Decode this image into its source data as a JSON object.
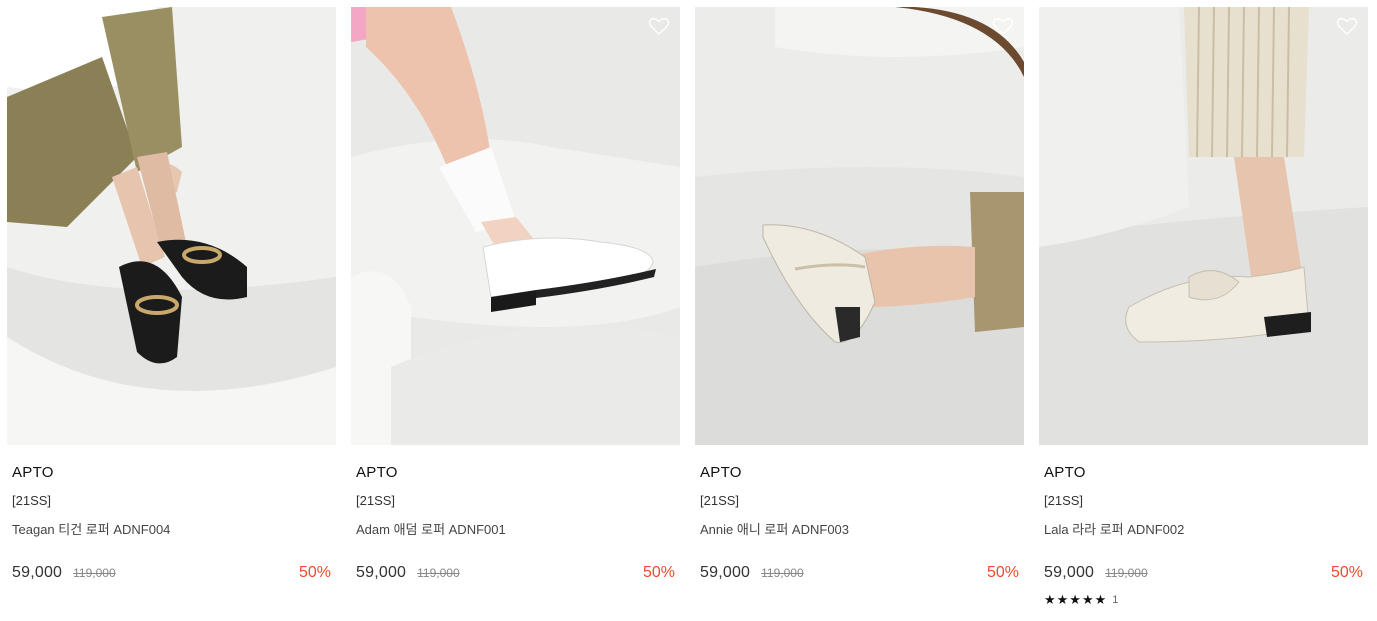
{
  "products": [
    {
      "brand": "APTO",
      "season": "[21SS]",
      "name": "Teagan 티건 로퍼 ADNF004",
      "price": "59,000",
      "original_price": "119,000",
      "discount": "50%",
      "image": "black loafer with gold chain, olive trousers"
    },
    {
      "brand": "APTO",
      "season": "[21SS]",
      "name": "Adam 애덤 로퍼 ADNF001",
      "price": "59,000",
      "original_price": "119,000",
      "discount": "50%",
      "image": "white penny loafer with white sock"
    },
    {
      "brand": "APTO",
      "season": "[21SS]",
      "name": "Annie 애니 로퍼 ADNF003",
      "price": "59,000",
      "original_price": "119,000",
      "discount": "50%",
      "image": "cream loafer with strap, beige trousers"
    },
    {
      "brand": "APTO",
      "season": "[21SS]",
      "name": "Lala 라라 로퍼 ADNF002",
      "price": "59,000",
      "original_price": "119,000",
      "discount": "50%",
      "rating": {
        "stars": "★★★★★",
        "count": "1"
      },
      "image": "cream knot loafer, striped trousers"
    }
  ],
  "colors": {
    "discount": "#ef4c24",
    "background": "#ffffff"
  },
  "icons": {
    "wishlist": "heart-outline-icon",
    "rating": "star-icon"
  }
}
